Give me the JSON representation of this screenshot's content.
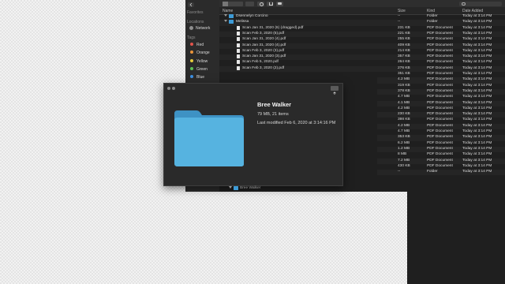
{
  "sidebar": {
    "favorites_label": "Favorites",
    "locations_label": "Locations",
    "network_label": "Network",
    "tags_label": "Tags",
    "tags": [
      {
        "label": "Red",
        "color": "#e2534b"
      },
      {
        "label": "Orange",
        "color": "#e9943a"
      },
      {
        "label": "Yellow",
        "color": "#e7cc3b"
      },
      {
        "label": "Green",
        "color": "#5cbf55"
      },
      {
        "label": "Blue",
        "color": "#3d8fe0"
      }
    ]
  },
  "columns": {
    "name": "Name",
    "size": "Size",
    "kind": "Kind",
    "date": "Date Added"
  },
  "rows": [
    {
      "name": "Dsennelyn Corcino",
      "size": "--",
      "kind": "Folder",
      "date": "Today at 3:14 PM",
      "type": "folder"
    },
    {
      "name": "Melissa",
      "size": "--",
      "kind": "Folder",
      "date": "Today at 3:14 PM",
      "type": "folder"
    },
    {
      "name": "Scan Jan 31, 2020 (6) (dragged).pdf",
      "size": "231 KB",
      "kind": "PDF Document",
      "date": "Today at 3:14 PM",
      "type": "file"
    },
    {
      "name": "Scan Feb 3, 2020 (5).pdf",
      "size": "221 KB",
      "kind": "PDF Document",
      "date": "Today at 3:14 PM",
      "type": "file"
    },
    {
      "name": "Scan Jan 31, 2020 (4).pdf",
      "size": "255 KB",
      "kind": "PDF Document",
      "date": "Today at 3:14 PM",
      "type": "file"
    },
    {
      "name": "Scan Jan 31, 2020 (4).pdf",
      "size": "409 KB",
      "kind": "PDF Document",
      "date": "Today at 3:14 PM",
      "type": "file"
    },
    {
      "name": "Scan Feb 3, 2020 (3).pdf",
      "size": "214 KB",
      "kind": "PDF Document",
      "date": "Today at 3:14 PM",
      "type": "file"
    },
    {
      "name": "Scan Jan 31, 2020 (3).pdf",
      "size": "357 KB",
      "kind": "PDF Document",
      "date": "Today at 3:14 PM",
      "type": "file"
    },
    {
      "name": "Scan Feb 5, 2020.pdf",
      "size": "264 KB",
      "kind": "PDF Document",
      "date": "Today at 3:14 PM",
      "type": "file"
    },
    {
      "name": "Scan Feb 3, 2020 (2).pdf",
      "size": "276 KB",
      "kind": "PDF Document",
      "date": "Today at 3:14 PM",
      "type": "file"
    }
  ],
  "right_rows": [
    {
      "size": "351 KB",
      "kind": "PDF Document",
      "date": "Today at 3:14 PM"
    },
    {
      "size": "4.2 MB",
      "kind": "PDF Document",
      "date": "Today at 3:14 PM"
    },
    {
      "size": "319 KB",
      "kind": "PDF Document",
      "date": "Today at 3:14 PM"
    },
    {
      "size": "378 KB",
      "kind": "PDF Document",
      "date": "Today at 3:14 PM"
    },
    {
      "size": "4.7 MB",
      "kind": "PDF Document",
      "date": "Today at 3:14 PM"
    },
    {
      "size": "4.1 MB",
      "kind": "PDF Document",
      "date": "Today at 3:14 PM"
    },
    {
      "size": "4.2 MB",
      "kind": "PDF Document",
      "date": "Today at 3:14 PM"
    },
    {
      "size": "230 KB",
      "kind": "PDF Document",
      "date": "Today at 3:14 PM"
    },
    {
      "size": "398 KB",
      "kind": "PDF Document",
      "date": "Today at 3:14 PM"
    },
    {
      "size": "4.2 MB",
      "kind": "PDF Document",
      "date": "Today at 3:14 PM"
    },
    {
      "size": "4.7 MB",
      "kind": "PDF Document",
      "date": "Today at 3:14 PM"
    },
    {
      "size": "353 KB",
      "kind": "PDF Document",
      "date": "Today at 3:14 PM"
    },
    {
      "size": "6.2 MB",
      "kind": "PDF Document",
      "date": "Today at 3:14 PM"
    },
    {
      "size": "1.2 MB",
      "kind": "PDF Document",
      "date": "Today at 3:14 PM"
    },
    {
      "size": "8 MB",
      "kind": "PDF Document",
      "date": "Today at 3:14 PM"
    },
    {
      "size": "7.2 MB",
      "kind": "PDF Document",
      "date": "Today at 3:14 PM"
    },
    {
      "size": "430 KB",
      "kind": "PDF Document",
      "date": "Today at 3:14 PM"
    },
    {
      "size": "--",
      "kind": "Folder",
      "date": "Today at 3:14 PM"
    }
  ],
  "bottom_folder": "Bree Walker",
  "info": {
    "title": "Bree Walker",
    "summary": "79 MB, 21 items",
    "modified": "Last modified Feb 6, 2020 at 3:14:16 PM",
    "folder_color": "#4aa8d8"
  }
}
